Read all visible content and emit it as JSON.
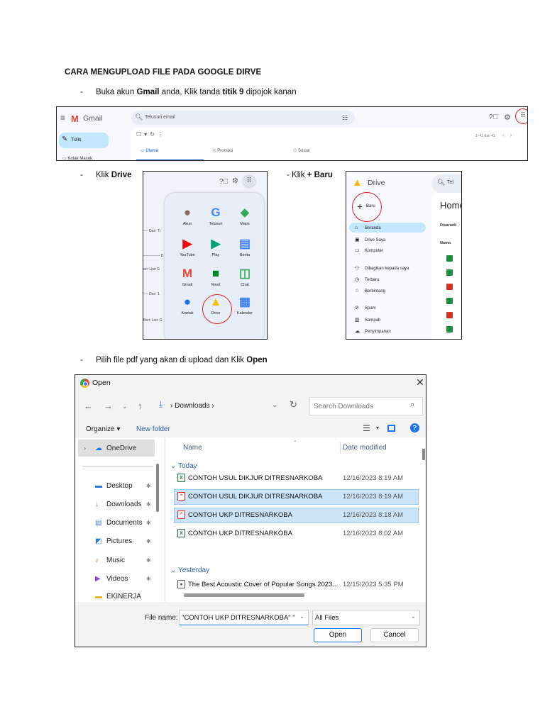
{
  "title": "CARA MENGUPLOAD FILE PADA GOOGLE DIRVE",
  "steps": {
    "s1": {
      "dash": "-",
      "a": "Buka akun ",
      "b": "Gmail",
      "c": " anda, Klik tanda ",
      "d": "titik 9",
      "e": " dipojok kanan"
    },
    "s2": {
      "dash": "-",
      "a": "Klik ",
      "b": "Drive"
    },
    "s3": {
      "a": "- Klik ",
      "b": "+ Baru"
    },
    "s4": {
      "dash": "-",
      "a": "Pilih file pdf yang akan di upload dan Klik ",
      "b": "Open"
    }
  },
  "gmail": {
    "app_name": "Gmail",
    "search_placeholder": "Telusuri email",
    "compose": "Tulis",
    "inbox": "Kotak Masuk",
    "inbox_count": "30",
    "count_text": "1–41 dari 41",
    "tabs": [
      "Utama",
      "Promosi",
      "Sosial"
    ],
    "icons": {
      "menu": "menu-icon",
      "search": "search-icon",
      "filter": "filter-icon",
      "help": "help-icon",
      "settings": "gear-icon",
      "apps": "apps-grid-icon"
    }
  },
  "apps_grid": {
    "side_texts": [
      "---- Dari: Ti",
      "-------------- D",
      "ari: Lion G",
      "---- Dari: 1",
      "Beri: Lion G"
    ],
    "items": [
      {
        "label": "Akun",
        "glyph": "●",
        "color": "#8a6e5a"
      },
      {
        "label": "Telusuri",
        "glyph": "G",
        "color": "#4285f4"
      },
      {
        "label": "Maps",
        "glyph": "⬥",
        "color": "#34a853"
      },
      {
        "label": "YouTube",
        "glyph": "▶",
        "color": "#ff0000"
      },
      {
        "label": "Play",
        "glyph": "▶",
        "color": "#00a173"
      },
      {
        "label": "Berita",
        "glyph": "▤",
        "color": "#4285f4"
      },
      {
        "label": "Gmail",
        "glyph": "M",
        "color": "#ea4335"
      },
      {
        "label": "Meet",
        "glyph": "■",
        "color": "#00832d"
      },
      {
        "label": "Chat",
        "glyph": "◫",
        "color": "#34a853"
      },
      {
        "label": "Kontak",
        "glyph": "●",
        "color": "#1a73e8"
      },
      {
        "label": "Drive",
        "glyph": "▲",
        "color": "#fbbc04"
      },
      {
        "label": "Kalender",
        "glyph": "▦",
        "color": "#4285f4"
      }
    ]
  },
  "drive": {
    "app_name": "Drive",
    "search_text": "Tel",
    "new_label": "Baru",
    "home_title": "Home",
    "suggested": "Disarank",
    "col_name": "Nama",
    "nav": [
      {
        "label": "Beranda",
        "icon": "home-icon",
        "glyph": "⌂"
      },
      {
        "label": "Drive Saya",
        "icon": "my-drive-icon",
        "glyph": "▣"
      },
      {
        "label": "Komputer",
        "icon": "computer-icon",
        "glyph": "▭"
      },
      {
        "label": "Dibagikan kepada saya",
        "icon": "shared-icon",
        "glyph": "⚇"
      },
      {
        "label": "Terbaru",
        "icon": "clock-icon",
        "glyph": "◷"
      },
      {
        "label": "Berbintang",
        "icon": "star-icon",
        "glyph": "☆"
      },
      {
        "label": "Spam",
        "icon": "spam-icon",
        "glyph": "⊘"
      },
      {
        "label": "Sampah",
        "icon": "trash-icon",
        "glyph": "▥"
      },
      {
        "label": "Penyimpanan",
        "icon": "cloud-icon",
        "glyph": "☁"
      }
    ],
    "file_colors": [
      "#1e8e3e",
      "#1e8e3e",
      "#d93025",
      "#1e8e3e",
      "#d93025",
      "#1e8e3e"
    ]
  },
  "dialog": {
    "title": "Open",
    "path_label": "Downloads",
    "search_placeholder": "Search Downloads",
    "organize": "Organize ▾",
    "new_folder": "New folder",
    "sidebar": [
      {
        "label": "OneDrive",
        "icon": "onedrive-icon",
        "glyph": "☁",
        "pinned": false
      },
      {
        "label": "Desktop",
        "icon": "desktop-icon",
        "glyph": "▬",
        "pinned": true
      },
      {
        "label": "Downloads",
        "icon": "downloads-icon",
        "glyph": "↓",
        "pinned": true
      },
      {
        "label": "Documents",
        "icon": "documents-icon",
        "glyph": "▤",
        "pinned": true
      },
      {
        "label": "Pictures",
        "icon": "pictures-icon",
        "glyph": "◩",
        "pinned": true
      },
      {
        "label": "Music",
        "icon": "music-icon",
        "glyph": "♪",
        "pinned": true
      },
      {
        "label": "Videos",
        "icon": "videos-icon",
        "glyph": "▶",
        "pinned": true
      },
      {
        "label": "EKINERJA",
        "icon": "folder-icon",
        "glyph": "▬",
        "pinned": false
      }
    ],
    "columns": {
      "name": "Name",
      "date": "Date modified"
    },
    "groups": {
      "today": "Today",
      "yesterday": "Yesterday"
    },
    "files": [
      {
        "name": "CONTOH USUL DIKJUR DITRESNARKOBA",
        "date": "12/16/2023 8:19 AM",
        "type": "x",
        "selected": false
      },
      {
        "name": "CONTOH USUL DIKJUR DITRESNARKOBA",
        "date": "12/16/2023 8:19 AM",
        "type": "p",
        "selected": true
      },
      {
        "name": "CONTOH UKP DITRESNARKOBA",
        "date": "12/16/2023 8:18 AM",
        "type": "p",
        "selected": true
      },
      {
        "name": "CONTOH UKP DITRESNARKOBA",
        "date": "12/16/2023 8:02 AM",
        "type": "x",
        "selected": false
      },
      {
        "name": "The Best Acoustic Cover of Popular Songs 2023...",
        "date": "12/15/2023 5:35 PM",
        "type": "m",
        "selected": false
      }
    ],
    "file_name_label": "File name:",
    "file_name_value": "\"CONTOH UKP DITRESNARKOBA\" \"CONTOH USUL DIKJUR DITRESNARKOBA\"",
    "file_type": "All Files",
    "open_btn": "Open",
    "cancel_btn": "Cancel"
  }
}
